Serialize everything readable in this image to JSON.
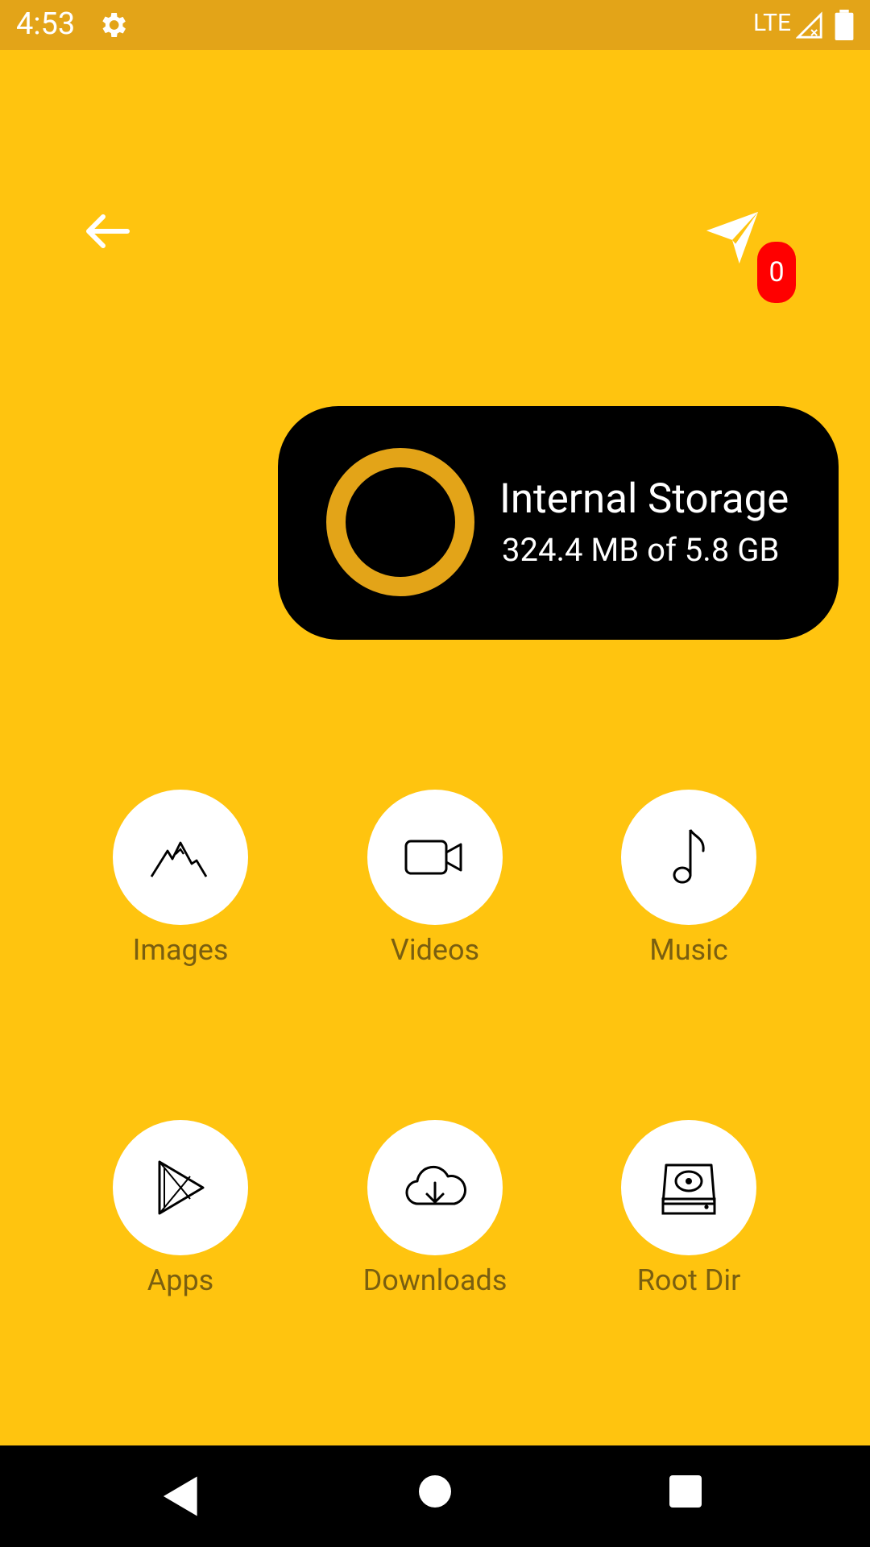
{
  "status_bar": {
    "time": "4:53",
    "network": "LTE"
  },
  "header": {
    "back_icon": "arrow-left-icon",
    "send_icon": "paper-plane-icon",
    "badge_count": "0"
  },
  "storage": {
    "title": "Internal Storage",
    "usage": "324.4 MB of 5.8 GB",
    "ring_color": "#E3A418"
  },
  "categories": [
    {
      "label": "Images",
      "icon": "mountain-icon"
    },
    {
      "label": "Videos",
      "icon": "video-camera-icon"
    },
    {
      "label": "Music",
      "icon": "music-note-icon"
    },
    {
      "label": "Apps",
      "icon": "play-store-icon"
    },
    {
      "label": "Downloads",
      "icon": "cloud-download-icon"
    },
    {
      "label": "Root Dir",
      "icon": "hard-drive-icon"
    }
  ],
  "colors": {
    "background": "#FFC40F",
    "status_bar": "#E3A418",
    "badge": "#FF0000",
    "card": "#000000"
  }
}
